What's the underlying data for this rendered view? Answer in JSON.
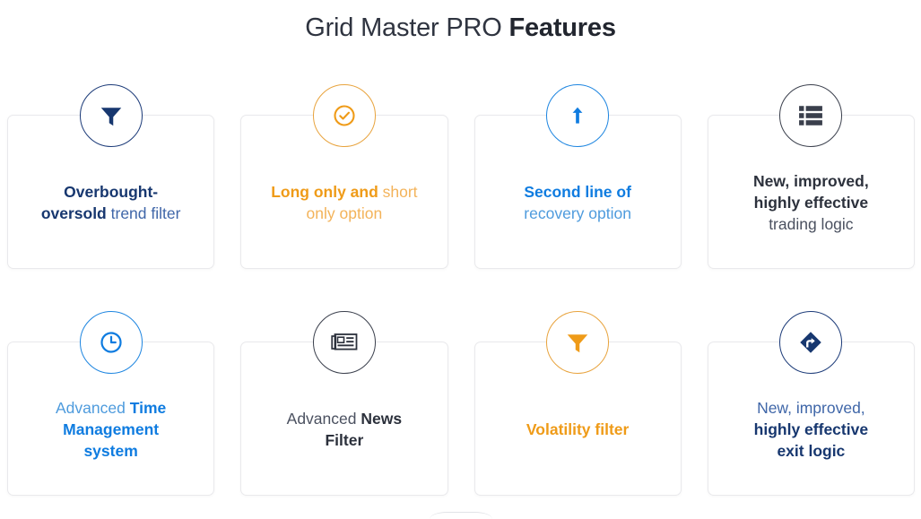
{
  "title": {
    "light": "Grid Master PRO ",
    "bold": "Features"
  },
  "colors": {
    "navy": "#17376f",
    "navy_light": "#3f66a8",
    "orange": "#ef9b18",
    "orange_light": "#f3b35a",
    "blue": "#0f7ce0",
    "blue_light": "#4e9bdd",
    "dark": "#2c313c",
    "dark_light": "#4b5160",
    "card_border": "#e9e9ec",
    "page_background": "#ffffff"
  },
  "cards": [
    {
      "icon": "funnel-icon",
      "icon_color": "#17376f",
      "circle_color": "#1b3a78",
      "tone": "navy",
      "line1_bold": "Overbought-",
      "line2_bold": "oversold ",
      "line2_light": "trend filter"
    },
    {
      "icon": "check-circle-icon",
      "icon_color": "#ef9b18",
      "circle_color": "#e8a33d",
      "tone": "orange",
      "line1_bold": "Long only and ",
      "line1_light": "short",
      "line2_light": "only option"
    },
    {
      "icon": "arrow-up-icon",
      "icon_color": "#0f7ce0",
      "circle_color": "#1d85e0",
      "tone": "blue",
      "line1_bold": "Second line of",
      "line2_light": "recovery option"
    },
    {
      "icon": "list-icon",
      "icon_color": "#3a3f4c",
      "circle_color": "#3a3f4c",
      "tone": "dark",
      "line1_bold": "New, improved,",
      "line2_bold": "highly effective",
      "line3_light": "trading logic"
    },
    {
      "icon": "clock-icon",
      "icon_color": "#0f7ce0",
      "circle_color": "#1d85e0",
      "tone": "blue",
      "line1_light": "Advanced ",
      "line1_bold": "Time",
      "line2_bold": "Management",
      "line3_bold": "system"
    },
    {
      "icon": "newspaper-icon",
      "icon_color": "#2c313c",
      "circle_color": "#3a3f4c",
      "tone": "dark",
      "line1_light": "Advanced ",
      "line1_bold": "News",
      "line2_bold": "Filter"
    },
    {
      "icon": "funnel-icon",
      "icon_color": "#ef9b18",
      "circle_color": "#e8a33d",
      "tone": "orange",
      "line1_bold": "Volatility filter"
    },
    {
      "icon": "directions-icon",
      "icon_color": "#17376f",
      "circle_color": "#1b3a78",
      "tone": "navy",
      "line1_light": "New, improved,",
      "line2_bold": "highly effective",
      "line3_bold": "exit logic"
    }
  ]
}
